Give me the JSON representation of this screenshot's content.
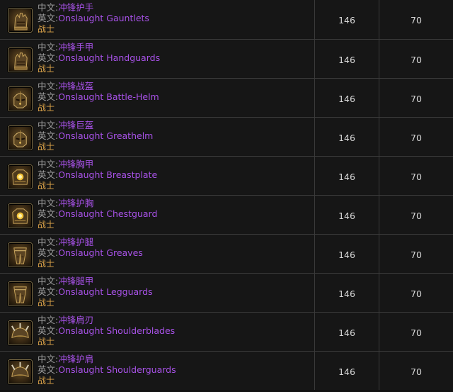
{
  "labels": {
    "zh": "中文:",
    "en": "英文:"
  },
  "rows": [
    {
      "zh": "冲锋护手",
      "en": "Onslaught Gauntlets",
      "class": "战士",
      "level": "146",
      "required": "70",
      "icon": "gauntlets-icon"
    },
    {
      "zh": "冲锋手甲",
      "en": "Onslaught Handguards",
      "class": "战士",
      "level": "146",
      "required": "70",
      "icon": "handguards-icon"
    },
    {
      "zh": "冲锋战盔",
      "en": "Onslaught Battle-Helm",
      "class": "战士",
      "level": "146",
      "required": "70",
      "icon": "helm-icon"
    },
    {
      "zh": "冲锋巨盔",
      "en": "Onslaught Greathelm",
      "class": "战士",
      "level": "146",
      "required": "70",
      "icon": "greathelm-icon"
    },
    {
      "zh": "冲锋胸甲",
      "en": "Onslaught Breastplate",
      "class": "战士",
      "level": "146",
      "required": "70",
      "icon": "breastplate-icon"
    },
    {
      "zh": "冲锋护胸",
      "en": "Onslaught Chestguard",
      "class": "战士",
      "level": "146",
      "required": "70",
      "icon": "chestguard-icon"
    },
    {
      "zh": "冲锋护腿",
      "en": "Onslaught Greaves",
      "class": "战士",
      "level": "146",
      "required": "70",
      "icon": "greaves-icon"
    },
    {
      "zh": "冲锋腿甲",
      "en": "Onslaught Legguards",
      "class": "战士",
      "level": "146",
      "required": "70",
      "icon": "legguards-icon"
    },
    {
      "zh": "冲锋肩刃",
      "en": "Onslaught Shoulderblades",
      "class": "战士",
      "level": "146",
      "required": "70",
      "icon": "shoulderblades-icon"
    },
    {
      "zh": "冲锋护肩",
      "en": "Onslaught Shoulderguards",
      "class": "战士",
      "level": "146",
      "required": "70",
      "icon": "shoulderguards-icon"
    }
  ],
  "colors": {
    "item_name": "#a852e8",
    "class_name": "#e0a64a",
    "label": "#9c9c9c",
    "number": "#d8d8d8"
  }
}
